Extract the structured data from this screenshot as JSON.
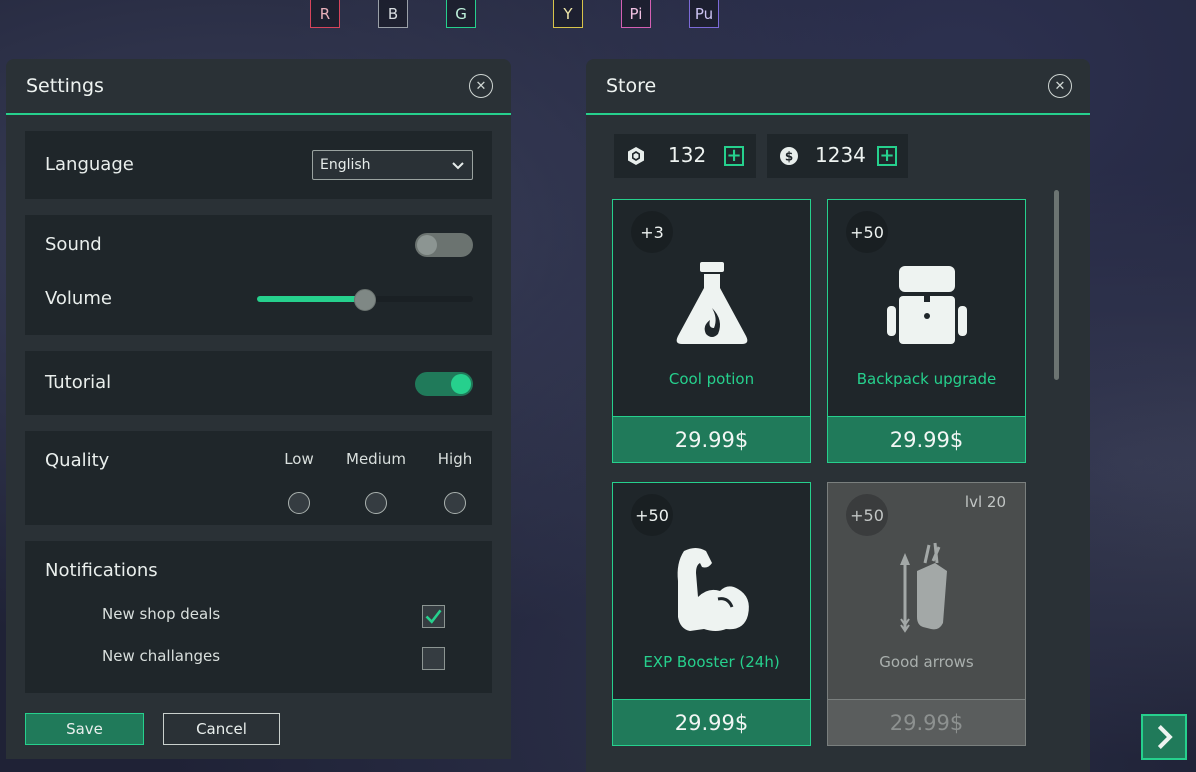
{
  "swatches": [
    {
      "label": "R",
      "color": "#d6445b"
    },
    {
      "label": "B",
      "color": "#9aa0a8"
    },
    {
      "label": "G",
      "color": "#26d08d"
    },
    {
      "label": "Y",
      "color": "#d8c44a"
    },
    {
      "label": "Pi",
      "color": "#d45fb3"
    },
    {
      "label": "Pu",
      "color": "#7c6ad8"
    }
  ],
  "settings": {
    "title": "Settings",
    "language_label": "Language",
    "language_value": "English",
    "sound_label": "Sound",
    "sound_on": false,
    "volume_label": "Volume",
    "volume_level": 0.5,
    "tutorial_label": "Tutorial",
    "tutorial_on": true,
    "quality_label": "Quality",
    "quality_options": [
      "Low",
      "Medium",
      "High"
    ],
    "notifications_label": "Notifications",
    "notifications": [
      {
        "label": "New shop deals",
        "checked": true
      },
      {
        "label": "New challanges",
        "checked": false
      }
    ],
    "save_label": "Save",
    "cancel_label": "Cancel"
  },
  "store": {
    "title": "Store",
    "gems": "132",
    "coins": "1234",
    "items": [
      {
        "badge": "+3",
        "name": "Cool potion",
        "price": "29.99$",
        "icon": "potion-icon",
        "locked": false,
        "level": ""
      },
      {
        "badge": "+50",
        "name": "Backpack upgrade",
        "price": "29.99$",
        "icon": "backpack-icon",
        "locked": false,
        "level": ""
      },
      {
        "badge": "+50",
        "name": "EXP Booster (24h)",
        "price": "29.99$",
        "icon": "muscle-icon",
        "locked": false,
        "level": ""
      },
      {
        "badge": "+50",
        "name": "Good arrows",
        "price": "29.99$",
        "icon": "quiver-icon",
        "locked": true,
        "level": "lvl 20"
      }
    ]
  },
  "accent_color": "#26d08d"
}
